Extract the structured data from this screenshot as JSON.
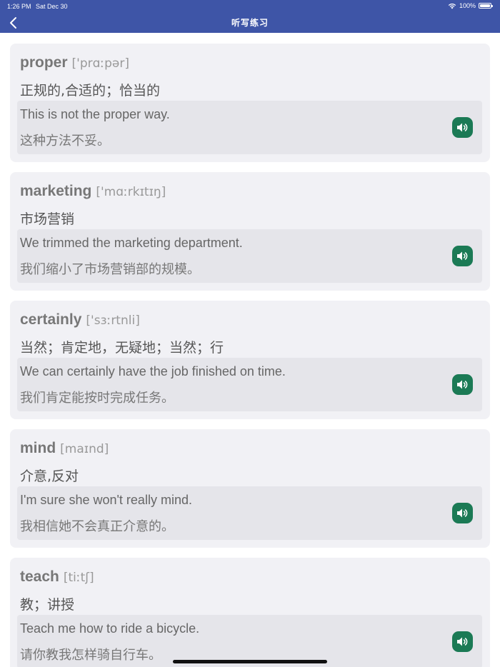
{
  "status_bar": {
    "time": "1:26 PM",
    "date": "Sat Dec 30",
    "battery": "100%"
  },
  "nav": {
    "title": "听写练习",
    "back_icon": "chevron-left-icon"
  },
  "colors": {
    "header": "#3e55a7",
    "card": "#f1f1f5",
    "example_box": "#e5e5ea",
    "speaker_button": "#1b7a55"
  },
  "entries": [
    {
      "word": "proper",
      "phonetic": "['prɑːpər]",
      "meaning": "正规的,合适的；恰当的",
      "example_en": "This is not the proper way.",
      "example_zh": "这种方法不妥。",
      "speaker_icon": "speaker-icon"
    },
    {
      "word": "marketing",
      "phonetic": "['mɑːrkɪtɪŋ]",
      "meaning": "市场营销",
      "example_en": "We trimmed the marketing department.",
      "example_zh": "我们缩小了市场营销部的规模。",
      "speaker_icon": "speaker-icon"
    },
    {
      "word": "certainly",
      "phonetic": "['sɜːrtnli]",
      "meaning": "当然；肯定地，无疑地；当然；行",
      "example_en": "We can certainly have the job finished on time.",
      "example_zh": "我们肯定能按时完成任务。",
      "speaker_icon": "speaker-icon"
    },
    {
      "word": "mind",
      "phonetic": "[maɪnd]",
      "meaning": "介意,反对",
      "example_en": "I'm sure she won't really mind.",
      "example_zh": "我相信她不会真正介意的。",
      "speaker_icon": "speaker-icon"
    },
    {
      "word": "teach",
      "phonetic": "[tiːtʃ]",
      "meaning": "教；讲授",
      "example_en": "Teach me how to ride a bicycle.",
      "example_zh": "请你教我怎样骑自行车。",
      "speaker_icon": "speaker-icon"
    }
  ]
}
